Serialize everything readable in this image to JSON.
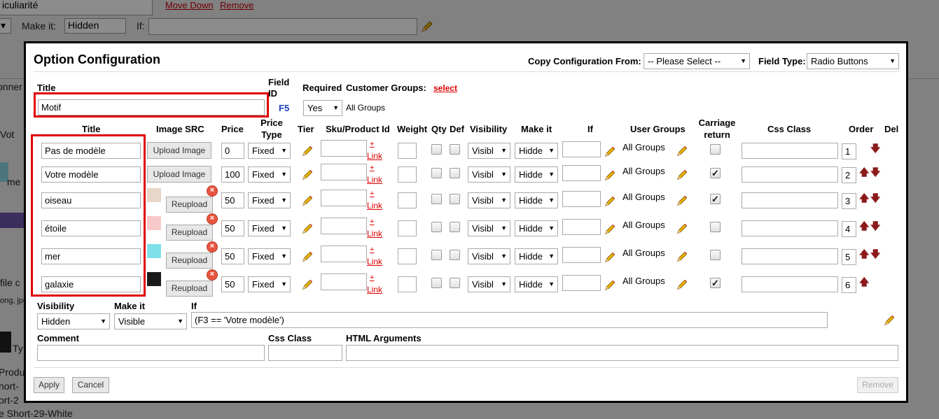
{
  "background": {
    "field_text": "iculiarité",
    "move_down": "Move Down",
    "remove": "Remove",
    "make_it_label": "Make it:",
    "make_it_value": "Hidden",
    "if_label": "If:",
    "snippets": [
      "onner",
      "Vot",
      "me",
      "file c",
      "ong, jpg",
      "Ty",
      "Produ",
      "hort-",
      "ort-2",
      "e Short-29-White"
    ]
  },
  "modal": {
    "title": "Option Configuration",
    "copy_config_label": "Copy Configuration From:",
    "copy_config_value": "-- Please Select --",
    "field_type_label": "Field Type:",
    "field_type_value": "Radio Buttons",
    "title_label": "Title",
    "title_value": "Motif",
    "field_id_label": "Field ID",
    "field_id_value": "F5",
    "required_label": "Required",
    "required_value": "Yes",
    "customer_groups_label": "Customer Groups:",
    "customer_groups_link": "select",
    "customer_groups_value": "All Groups",
    "columns": {
      "title": "Title",
      "image_src": "Image SRC",
      "price": "Price",
      "price_type": "Price Type",
      "tier": "Tier",
      "sku": "Sku/Product Id",
      "weight": "Weight",
      "qty": "Qty",
      "def": "Def",
      "visibility": "Visibility",
      "make_it": "Make it",
      "if": "If",
      "user_groups": "User Groups",
      "carriage_return": "Carriage return",
      "css_class": "Css Class",
      "order": "Order",
      "del": "Del"
    },
    "rows": [
      {
        "title": "Pas de modèle",
        "image_button": "Upload Image",
        "price": "0",
        "price_type": "Fixed",
        "link_plus": "+",
        "link": "Link",
        "visibility": "Visibl",
        "make_it": "Hidde",
        "user_groups": "All Groups",
        "carriage": false,
        "order": "1"
      },
      {
        "title": "Votre modèle",
        "image_button": "Upload Image",
        "price": "100",
        "price_type": "Fixed",
        "link_plus": "+",
        "link": "Link",
        "visibility": "Visibl",
        "make_it": "Hidde",
        "user_groups": "All Groups",
        "carriage": true,
        "order": "2"
      },
      {
        "title": "oiseau",
        "image_button": "Reupload",
        "price": "50",
        "price_type": "Fixed",
        "link_plus": "+",
        "link": "Link",
        "visibility": "Visibl",
        "make_it": "Hidde",
        "user_groups": "All Groups",
        "carriage": true,
        "order": "3"
      },
      {
        "title": "étoile",
        "image_button": "Reupload",
        "price": "50",
        "price_type": "Fixed",
        "link_plus": "+",
        "link": "Link",
        "visibility": "Visibl",
        "make_it": "Hidde",
        "user_groups": "All Groups",
        "carriage": false,
        "order": "4"
      },
      {
        "title": "mer",
        "image_button": "Reupload",
        "price": "50",
        "price_type": "Fixed",
        "link_plus": "+",
        "link": "Link",
        "visibility": "Visibl",
        "make_it": "Hidde",
        "user_groups": "All Groups",
        "carriage": false,
        "order": "5"
      },
      {
        "title": "galaxie",
        "image_button": "Reupload",
        "price": "50",
        "price_type": "Fixed",
        "link_plus": "+",
        "link": "Link",
        "visibility": "Visibl",
        "make_it": "Hidde",
        "user_groups": "All Groups",
        "carriage": true,
        "order": "6"
      }
    ],
    "visibility_label": "Visibility",
    "visibility_value": "Hidden",
    "make_it_label": "Make it",
    "make_it_value": "Visible",
    "if_label": "If",
    "if_value": "(F3 == 'Votre modèle')",
    "comment_label": "Comment",
    "css_class_label": "Css Class",
    "html_args_label": "HTML Arguments",
    "apply": "Apply",
    "cancel": "Cancel",
    "remove": "Remove"
  },
  "colors": {
    "highlight": "#e00000",
    "link_red": "#d00000",
    "field_id_blue": "#1a3fbf",
    "arrow": "#8b1a1a"
  },
  "icons": [
    "pencil-icon",
    "move-down-arrow-icon",
    "move-up-arrow-icon",
    "remove-image-icon",
    "checkmark-icon",
    "dropdown-caret-icon"
  ]
}
